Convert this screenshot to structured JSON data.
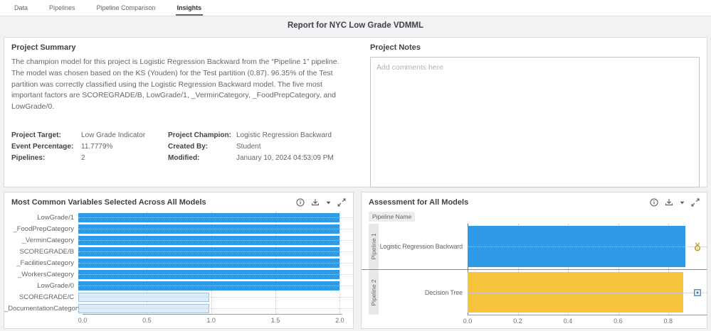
{
  "tabs": {
    "items": [
      {
        "label": "Data",
        "active": false
      },
      {
        "label": "Pipelines",
        "active": false
      },
      {
        "label": "Pipeline Comparison",
        "active": false
      },
      {
        "label": "Insights",
        "active": true
      }
    ]
  },
  "header": {
    "title": "Report for NYC Low Grade VDMML"
  },
  "summary": {
    "heading": "Project Summary",
    "text": "The champion model for this project is Logistic Regression Backward from the “Pipeline 1” pipeline. The model was chosen based on the KS (Youden) for the Test partition (0.87). 96.35% of the Test partition was correctly classified using the Logistic Regression Backward model.  The five most important factors are SCOREGRADE/B, LowGrade/1, _VerminCategory, _FoodPrepCategory, and LowGrade/0."
  },
  "details": {
    "columns": [
      [
        {
          "label": "Project Target:",
          "value": "Low Grade Indicator"
        },
        {
          "label": "Event Percentage:",
          "value": "11.7779%"
        },
        {
          "label": "Pipelines:",
          "value": "2"
        }
      ],
      [
        {
          "label": "Project Champion:",
          "value": "Logistic Regression Backward"
        },
        {
          "label": "Created By:",
          "value": "Student"
        },
        {
          "label": "Modified:",
          "value": "January 10, 2024 04:53:09 PM"
        }
      ]
    ]
  },
  "notes": {
    "heading": "Project Notes",
    "placeholder": "Add comments here"
  },
  "chart_data": [
    {
      "type": "bar",
      "orientation": "horizontal",
      "title": "Most Common Variables Selected Across All Models",
      "categories": [
        "LowGrade/1",
        "_FoodPrepCategory",
        "_VerminCategory",
        "SCOREGRADE/B",
        "_FacilitiesCategory",
        "_WorkersCategory",
        "LowGrade/0",
        "SCOREGRADE/C",
        "_DocumentationCategory"
      ],
      "values": [
        2,
        2,
        2,
        2,
        2,
        2,
        2,
        1,
        1
      ],
      "bar_styles": [
        "solid",
        "solid",
        "solid",
        "solid",
        "solid",
        "solid",
        "solid",
        "faded",
        "faded"
      ],
      "bar_color": "#2F9BE6",
      "faded_color": "#DCEBF8",
      "xticks": [
        0,
        0.5,
        1,
        1.5,
        2
      ],
      "xtick_labels": [
        "0.0",
        "0.5",
        "1.0",
        "1.5",
        "2.0"
      ],
      "xlim": [
        0,
        2.02
      ],
      "grid": "dotted-vertical"
    },
    {
      "type": "bar",
      "orientation": "horizontal",
      "title": "Assessment for All Models",
      "group_header": "Pipeline Name",
      "groups": [
        {
          "group": "Pipeline 1",
          "model": "Logistic Regression Backward",
          "value": 0.87,
          "color": "#2F9BE6",
          "badge": "champion-medal-icon"
        },
        {
          "group": "Pipeline 2",
          "model": "Decision Tree",
          "value": 0.86,
          "color": "#F5C33C",
          "badge": "model-marker-icon"
        }
      ],
      "xticks": [
        0,
        0.2,
        0.4,
        0.6,
        0.8
      ],
      "xtick_labels": [
        "0.0",
        "0.2",
        "0.4",
        "0.6",
        "0.8"
      ],
      "xlim": [
        0,
        0.88
      ],
      "grid": "dotted-vertical"
    }
  ],
  "colors": {
    "accent_blue": "#2F9BE6",
    "accent_yellow": "#F5C33C",
    "faded_blue": "#DCEBF8",
    "active_tab_underline": "#63666A"
  }
}
